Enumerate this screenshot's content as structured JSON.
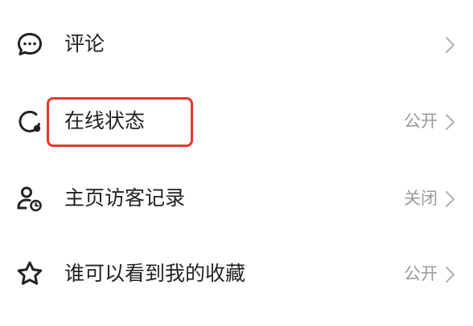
{
  "settings": {
    "items": [
      {
        "icon": "comment-bubble-icon",
        "label": "评论",
        "value": ""
      },
      {
        "icon": "online-status-icon",
        "label": "在线状态",
        "value": "公开"
      },
      {
        "icon": "visitor-record-icon",
        "label": "主页访客记录",
        "value": "关闭"
      },
      {
        "icon": "star-icon",
        "label": "谁可以看到我的收藏",
        "value": "公开"
      }
    ]
  },
  "colors": {
    "text": "#222222",
    "secondary_text": "#9a9a9a",
    "chevron": "#b5b5b5",
    "highlight_border": "#e2382f"
  }
}
